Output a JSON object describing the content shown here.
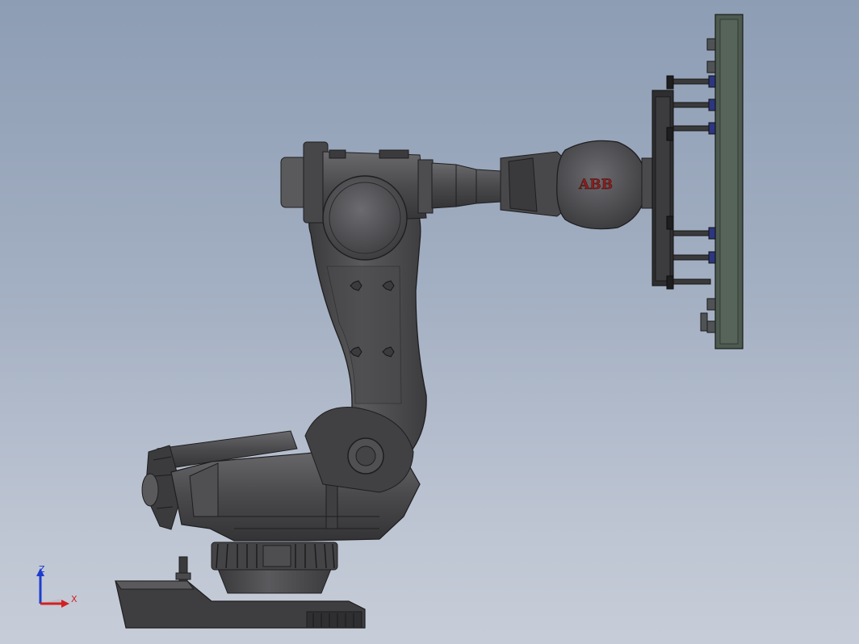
{
  "viewport": {
    "background_top": "#8d9db4",
    "background_bottom": "#c7cdd8"
  },
  "model": {
    "logo_text": "ABB",
    "logo_color": "#8b1e1e",
    "body_color": "#4d4d4f",
    "tool_color": "#4c5a4f"
  },
  "triad": {
    "z_label": "Z",
    "x_label": "X",
    "z_color": "#1f3ccf",
    "x_color": "#d32020"
  }
}
